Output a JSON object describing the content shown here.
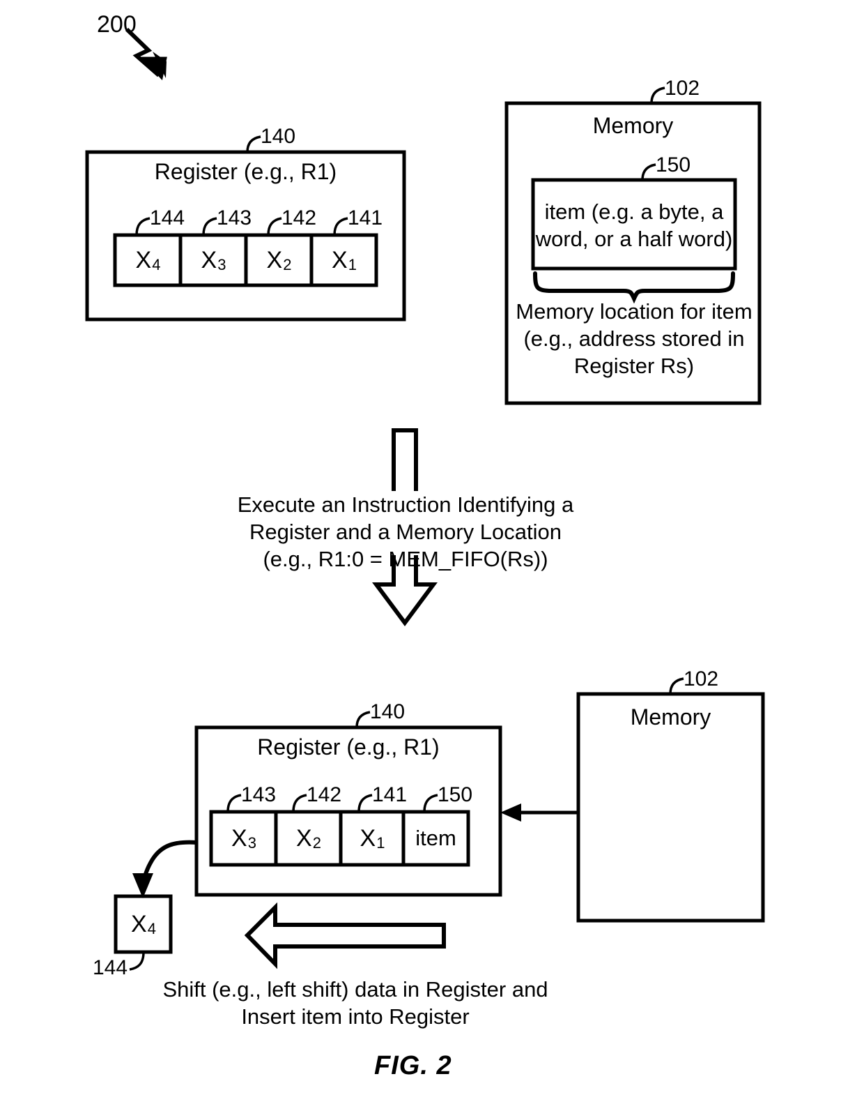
{
  "figure": {
    "number_label": "200",
    "caption": "FIG. 2"
  },
  "top_section": {
    "register": {
      "ref": "140",
      "title": "Register (e.g., R1)",
      "cells": [
        {
          "ref": "144",
          "value": "X",
          "sub": "4"
        },
        {
          "ref": "143",
          "value": "X",
          "sub": "3"
        },
        {
          "ref": "142",
          "value": "X",
          "sub": "2"
        },
        {
          "ref": "141",
          "value": "X",
          "sub": "1"
        }
      ]
    },
    "memory": {
      "ref": "102",
      "title": "Memory",
      "item_box": {
        "ref": "150",
        "text": "item (e.g. a byte, a\nword, or a half word)"
      },
      "brace_caption": "Memory location for item\n(e.g., address stored in\nRegister Rs)"
    }
  },
  "transition": {
    "instruction_text": "Execute an Instruction Identifying a\nRegister and a Memory Location\n(e.g., R1:0 = MEM_FIFO(Rs))"
  },
  "bottom_section": {
    "register": {
      "ref": "140",
      "title": "Register (e.g., R1)",
      "cells": [
        {
          "ref": "143",
          "value": "X",
          "sub": "3"
        },
        {
          "ref": "142",
          "value": "X",
          "sub": "2"
        },
        {
          "ref": "141",
          "value": "X",
          "sub": "1"
        },
        {
          "ref": "150",
          "value": "item",
          "sub": ""
        }
      ]
    },
    "memory": {
      "ref": "102",
      "title": "Memory"
    },
    "shifted_out": {
      "ref": "144",
      "value": "X",
      "sub": "4"
    },
    "shift_caption": "Shift (e.g., left shift) data in Register and\nInsert item into Register"
  }
}
